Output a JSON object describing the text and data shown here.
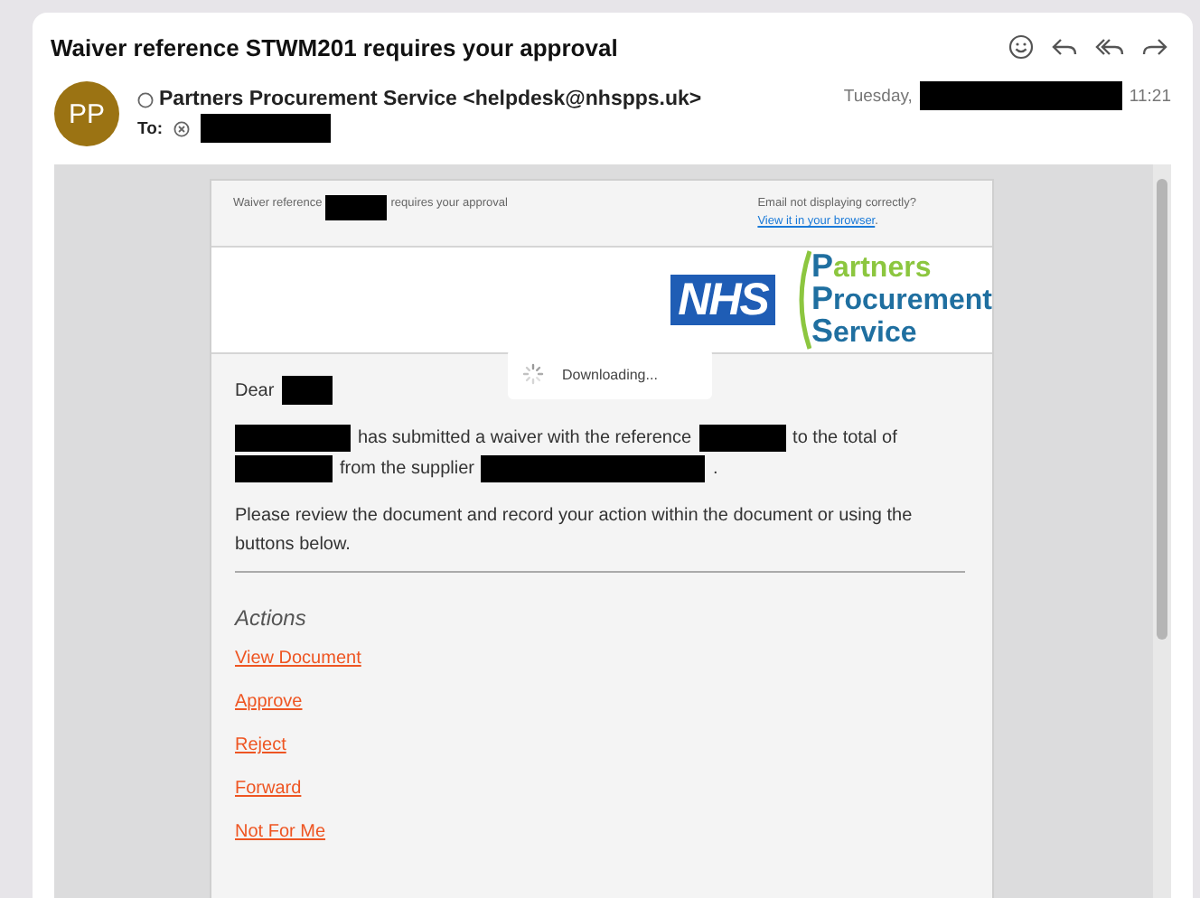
{
  "message": {
    "subject": "Waiver reference STWM201 requires your approval",
    "avatar": "PP",
    "sender": "Partners Procurement Service <helpdesk@nhspps.uk>",
    "to_label": "To:",
    "date": [
      {
        "kind": "text",
        "text": "Tuesday,"
      },
      {
        "kind": "redacted"
      },
      {
        "kind": "text",
        "text": "11:21"
      }
    ]
  },
  "email": {
    "preheader": [
      {
        "kind": "text",
        "text": "Waiver reference"
      },
      {
        "kind": "redacted"
      },
      {
        "kind": "text",
        "text": "requires your approval"
      }
    ],
    "not_displaying": "Email not displaying correctly?",
    "browser_link": "View it in your browser",
    "browser_link_end": ".",
    "nhs_logo": "NHS",
    "pps_logo": [
      {
        "text": "Partners",
        "color": "#8cc63f"
      },
      {
        "text": "Procurement",
        "color": "#1f6fa0"
      },
      {
        "text": "Service",
        "color": "#1f6fa0"
      }
    ],
    "greeting": [
      {
        "kind": "text",
        "text": "Dear"
      },
      {
        "kind": "redacted"
      }
    ],
    "paragraph": [
      {
        "kind": "redacted"
      },
      {
        "kind": "text",
        "text": "has submitted a waiver with the reference"
      },
      {
        "kind": "redacted"
      },
      {
        "kind": "text",
        "text": "to the total of"
      },
      {
        "kind": "redacted"
      },
      {
        "kind": "text",
        "text": "from the supplier"
      },
      {
        "kind": "redacted"
      },
      {
        "kind": "text",
        "text": "."
      }
    ],
    "instructions": "Please review the document and record your action within the document or using the buttons below.",
    "actions_heading": "Actions",
    "actions": [
      "View Document",
      "Approve",
      "Reject",
      "Forward",
      "Not For Me"
    ]
  },
  "toast": {
    "text": "Downloading..."
  }
}
